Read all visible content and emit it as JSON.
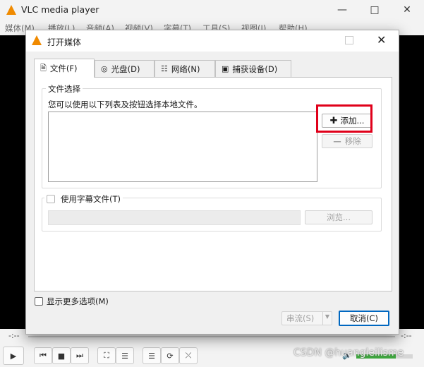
{
  "vlc_window": {
    "title": "VLC media player",
    "menu": [
      "媒体(M)",
      "播放(L)",
      "音频(A)",
      "视频(V)",
      "字幕(T)",
      "工具(S)",
      "视图(I)",
      "帮助(H)"
    ],
    "seek_left": "-:--",
    "seek_right": "-:--"
  },
  "dialog": {
    "title": "打开媒体",
    "tabs": [
      {
        "label": "文件(F)",
        "icon": "file-icon"
      },
      {
        "label": "光盘(D)",
        "icon": "disc-icon"
      },
      {
        "label": "网络(N)",
        "icon": "network-icon"
      },
      {
        "label": "捕获设备(D)",
        "icon": "capture-icon"
      }
    ],
    "file_selection": {
      "group_label": "文件选择",
      "hint": "您可以使用以下列表及按钮选择本地文件。",
      "add_label": "添加...",
      "remove_label": "移除"
    },
    "subtitle": {
      "checkbox_label": "使用字幕文件(T)",
      "browse_label": "浏览..."
    },
    "more_options_label": "显示更多选项(M)",
    "stream_label": "串流(S)",
    "cancel_label": "取消(C)"
  },
  "watermark": "CSDN @huangleilisme",
  "colors": {
    "highlight": "#e0001a",
    "vlc_orange": "#f08a00",
    "accent": "#0067c0"
  }
}
